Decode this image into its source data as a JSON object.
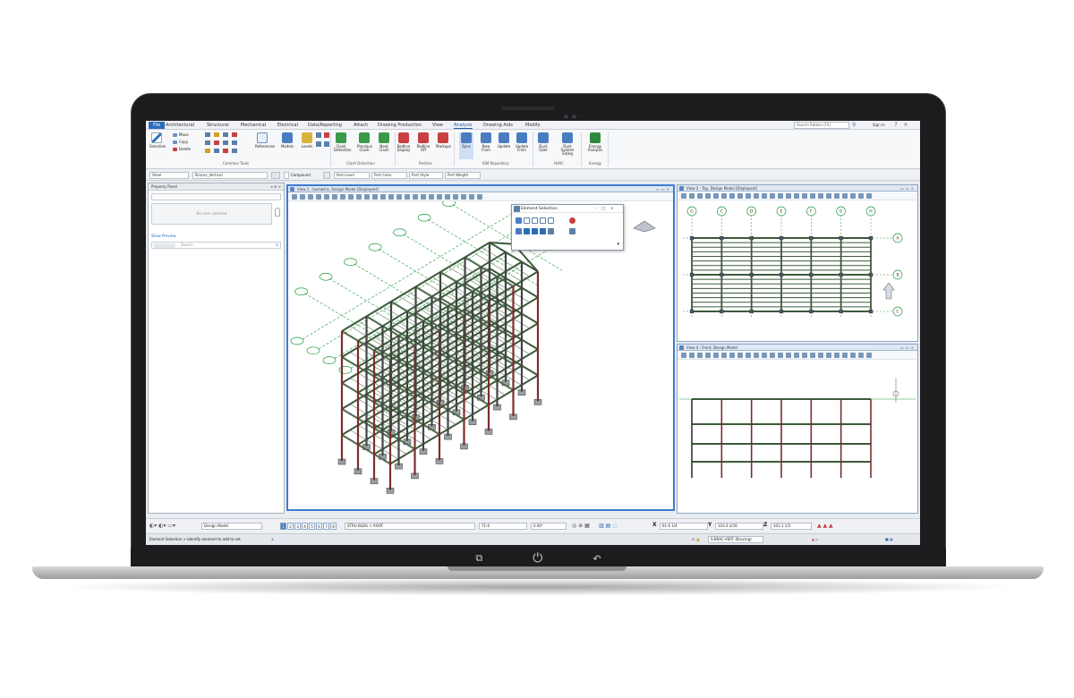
{
  "ribbon_tabs": [
    "File",
    "Architectural",
    "Structural",
    "Mechanical",
    "Electrical",
    "Data/Reporting",
    "Attach",
    "Drawing Production",
    "View",
    "Analysis",
    "Drawing Aids",
    "Modify"
  ],
  "active_tab": "Analysis",
  "search_placeholder": "Search Ribbon (F4)",
  "sign_in": "Sign in",
  "ribbon": {
    "selection": "Selection",
    "move": "Move",
    "copy": "Copy",
    "delete": "Delete",
    "references": "References",
    "models": "Models",
    "levels": "Levels",
    "clash_detection": "Clash Detection",
    "previous_clash": "Previous Clash",
    "next_clash": "Next Clash",
    "redline_display": "Redline Display",
    "redline_off": "Redline Off",
    "markups": "Markups",
    "sync": "Sync",
    "new_from": "New From",
    "update": "Update",
    "update_from": "Update From",
    "duct_sizer": "Duct Sizer",
    "duct_system_sizing": "Duct System Sizing",
    "energy_analysis": "Energy Analysis",
    "groups": {
      "common_tools": "Common Tools",
      "clash_detection": "Clash Detection",
      "redline": "Redline",
      "ism_repository": "ISM Repository",
      "hvac": "HVAC",
      "energy": "Energy"
    }
  },
  "attr_bar": {
    "material": "Steel",
    "element": "Braces_Vertical",
    "compound": "Compound",
    "part_level": "Part Level",
    "part_color": "Part Color",
    "part_style": "Part Style",
    "part_weight": "Part Weight"
  },
  "property_panel": {
    "title": "Property Panel",
    "no_item": "No item selected",
    "show_preview": "Show Preview",
    "search_placeholder": "Search"
  },
  "views": {
    "view1": "View 1 - Isometric, Design Model [Displayset]",
    "view2": "View 2 - Top, Design Model [Displayset]",
    "view4": "View 4 - Front, Design Model"
  },
  "grid_bubbles_top": [
    "G",
    "C",
    "D",
    "E",
    "F",
    "G",
    "H"
  ],
  "grid_bubbles_side": [
    "A",
    "B",
    "C"
  ],
  "element_selection": {
    "title": "Element Selection"
  },
  "statusbar": {
    "model": "Design Model",
    "view_buttons": [
      "1",
      "2",
      "3",
      "4",
      "5",
      "6",
      "7",
      "8"
    ],
    "level": "STRU BLDG > ROOF",
    "scale": "71:6",
    "angle": "0.00°",
    "x_label": "X",
    "x_value": "61:6 1/4",
    "y_label": "Y",
    "y_value": "103:3 3/16",
    "z_label": "Z",
    "z_value": "101:1 1/2",
    "prompt": "Element Selection > Identify element to add to set",
    "active_level": "S-BRAC-VERT (Bracing)"
  },
  "device_buttons": [
    "⧉",
    "⏻",
    "↶"
  ],
  "colors": {
    "ribbon_blue": "#2b6cb6",
    "frame": "#1c1c1e",
    "steel_green": "#3c5a3a",
    "column_red": "#7a2e2e",
    "grid_green": "#1e9a3a"
  }
}
